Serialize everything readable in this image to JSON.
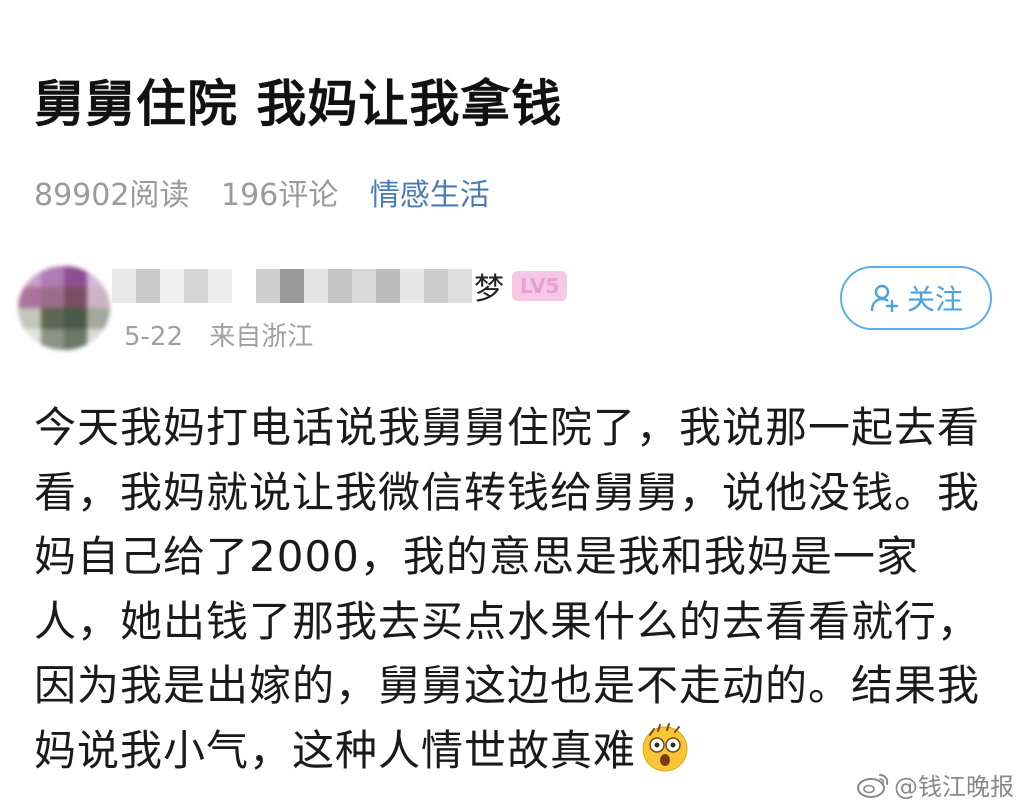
{
  "post": {
    "title": "舅舅住院 我妈让我拿钱",
    "reads": "89902阅读",
    "comments": "196评论",
    "category": "情感生活"
  },
  "author": {
    "name_visible": "梦",
    "level": "LV5",
    "date": "5-22",
    "location": "来自浙江",
    "follow_label": "关注"
  },
  "content": {
    "text": "今天我妈打电话说我舅舅住院了，我说那一起去看看，我妈就说让我微信转钱给舅舅，说他没钱。我妈自己给了2000，我的意思是我和我妈是一家人，她出钱了那我去买点水果什么的去看看就行，因为我是出嫁的，舅舅这边也是不走动的。结果我妈说我小气，这种人情世故真难"
  },
  "watermark": {
    "text": "@钱江晚报"
  },
  "colors": {
    "accent_blue": "#4a7bb8",
    "follow_border": "#5aaee8",
    "level_badge_bg": "#f5c8e6",
    "meta_gray": "#9a9a9a"
  },
  "icons": {
    "follow": "add-user-icon",
    "emoji": "shocked-face-icon",
    "watermark": "weibo-logo-icon"
  }
}
